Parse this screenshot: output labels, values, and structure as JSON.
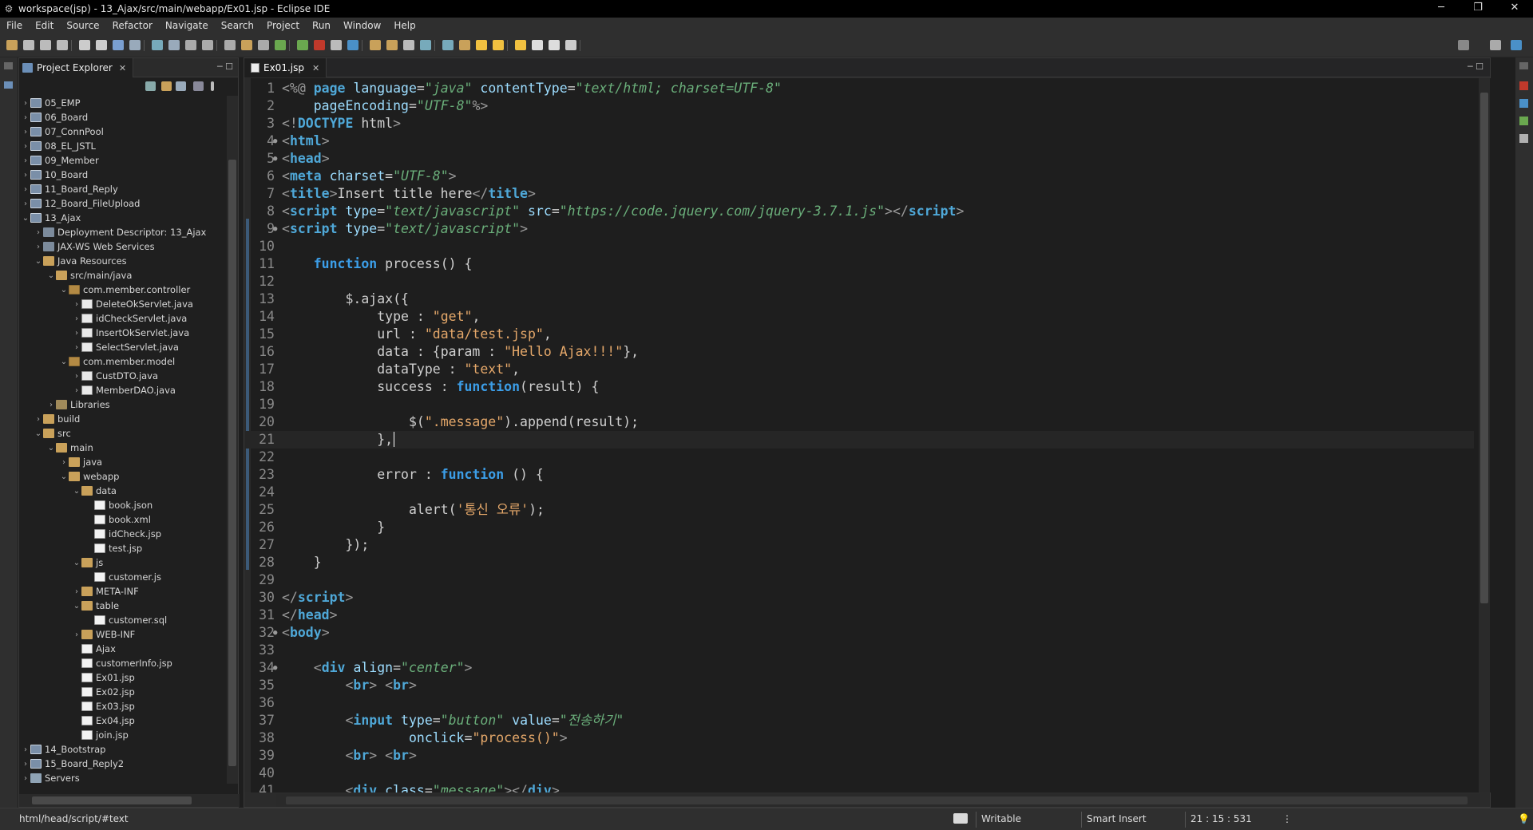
{
  "window": {
    "title": "workspace(jsp) - 13_Ajax/src/main/webapp/Ex01.jsp - Eclipse IDE",
    "minimize": "─",
    "restore": "❐",
    "close": "✕"
  },
  "menu": [
    "File",
    "Edit",
    "Source",
    "Refactor",
    "Navigate",
    "Search",
    "Project",
    "Run",
    "Window",
    "Help"
  ],
  "explorer": {
    "tab_label": "Project Explorer",
    "close": "✕",
    "minmax": "─ ☐",
    "tree": [
      {
        "label": "05_EMP",
        "depth": 0,
        "arrow": "›",
        "icon": "project"
      },
      {
        "label": "06_Board",
        "depth": 0,
        "arrow": "›",
        "icon": "project"
      },
      {
        "label": "07_ConnPool",
        "depth": 0,
        "arrow": "›",
        "icon": "project"
      },
      {
        "label": "08_EL_JSTL",
        "depth": 0,
        "arrow": "›",
        "icon": "project"
      },
      {
        "label": "09_Member",
        "depth": 0,
        "arrow": "›",
        "icon": "project"
      },
      {
        "label": "10_Board",
        "depth": 0,
        "arrow": "›",
        "icon": "project"
      },
      {
        "label": "11_Board_Reply",
        "depth": 0,
        "arrow": "›",
        "icon": "project"
      },
      {
        "label": "12_Board_FileUpload",
        "depth": 0,
        "arrow": "›",
        "icon": "project"
      },
      {
        "label": "13_Ajax",
        "depth": 0,
        "arrow": "⌄",
        "icon": "project"
      },
      {
        "label": "Deployment Descriptor: 13_Ajax",
        "depth": 1,
        "arrow": "›",
        "icon": "cfg"
      },
      {
        "label": "JAX-WS Web Services",
        "depth": 1,
        "arrow": "›",
        "icon": "cfg"
      },
      {
        "label": "Java Resources",
        "depth": 1,
        "arrow": "⌄",
        "icon": "folder"
      },
      {
        "label": "src/main/java",
        "depth": 2,
        "arrow": "⌄",
        "icon": "folder"
      },
      {
        "label": "com.member.controller",
        "depth": 3,
        "arrow": "⌄",
        "icon": "package"
      },
      {
        "label": "DeleteOkServlet.java",
        "depth": 4,
        "arrow": "›",
        "icon": "java"
      },
      {
        "label": "idCheckServlet.java",
        "depth": 4,
        "arrow": "›",
        "icon": "java"
      },
      {
        "label": "InsertOkServlet.java",
        "depth": 4,
        "arrow": "›",
        "icon": "java"
      },
      {
        "label": "SelectServlet.java",
        "depth": 4,
        "arrow": "›",
        "icon": "java"
      },
      {
        "label": "com.member.model",
        "depth": 3,
        "arrow": "⌄",
        "icon": "package"
      },
      {
        "label": "CustDTO.java",
        "depth": 4,
        "arrow": "›",
        "icon": "java"
      },
      {
        "label": "MemberDAO.java",
        "depth": 4,
        "arrow": "›",
        "icon": "java"
      },
      {
        "label": "Libraries",
        "depth": 2,
        "arrow": "›",
        "icon": "lib"
      },
      {
        "label": "build",
        "depth": 1,
        "arrow": "›",
        "icon": "folder"
      },
      {
        "label": "src",
        "depth": 1,
        "arrow": "⌄",
        "icon": "folder"
      },
      {
        "label": "main",
        "depth": 2,
        "arrow": "⌄",
        "icon": "folder"
      },
      {
        "label": "java",
        "depth": 3,
        "arrow": "›",
        "icon": "folder"
      },
      {
        "label": "webapp",
        "depth": 3,
        "arrow": "⌄",
        "icon": "folder"
      },
      {
        "label": "data",
        "depth": 4,
        "arrow": "⌄",
        "icon": "folder"
      },
      {
        "label": "book.json",
        "depth": 5,
        "arrow": "",
        "icon": "jsp"
      },
      {
        "label": "book.xml",
        "depth": 5,
        "arrow": "",
        "icon": "jsp"
      },
      {
        "label": "idCheck.jsp",
        "depth": 5,
        "arrow": "",
        "icon": "jsp"
      },
      {
        "label": "test.jsp",
        "depth": 5,
        "arrow": "",
        "icon": "jsp"
      },
      {
        "label": "js",
        "depth": 4,
        "arrow": "⌄",
        "icon": "folder"
      },
      {
        "label": "customer.js",
        "depth": 5,
        "arrow": "",
        "icon": "jsp"
      },
      {
        "label": "META-INF",
        "depth": 4,
        "arrow": "›",
        "icon": "folder"
      },
      {
        "label": "table",
        "depth": 4,
        "arrow": "⌄",
        "icon": "folder"
      },
      {
        "label": "customer.sql",
        "depth": 5,
        "arrow": "",
        "icon": "jsp"
      },
      {
        "label": "WEB-INF",
        "depth": 4,
        "arrow": "›",
        "icon": "folder"
      },
      {
        "label": "Ajax",
        "depth": 4,
        "arrow": "",
        "icon": "jsp"
      },
      {
        "label": "customerInfo.jsp",
        "depth": 4,
        "arrow": "",
        "icon": "jsp"
      },
      {
        "label": "Ex01.jsp",
        "depth": 4,
        "arrow": "",
        "icon": "jsp"
      },
      {
        "label": "Ex02.jsp",
        "depth": 4,
        "arrow": "",
        "icon": "jsp"
      },
      {
        "label": "Ex03.jsp",
        "depth": 4,
        "arrow": "",
        "icon": "jsp"
      },
      {
        "label": "Ex04.jsp",
        "depth": 4,
        "arrow": "",
        "icon": "jsp"
      },
      {
        "label": "join.jsp",
        "depth": 4,
        "arrow": "",
        "icon": "jsp"
      },
      {
        "label": "14_Bootstrap",
        "depth": 0,
        "arrow": "›",
        "icon": "project"
      },
      {
        "label": "15_Board_Reply2",
        "depth": 0,
        "arrow": "›",
        "icon": "project"
      },
      {
        "label": "Servers",
        "depth": 0,
        "arrow": "›",
        "icon": "server"
      }
    ]
  },
  "editor": {
    "tab_label": "Ex01.jsp",
    "close": "✕",
    "minmax": "─ ☐",
    "current_line": 21,
    "lines": [
      {
        "n": "1",
        "fold": "",
        "html": "<span class='pun'>&lt;%@</span> <span class='tag'>page</span> <span class='attr'>language</span><span class='jsp'>=</span><span class='aval'>\"java\"</span> <span class='attr'>contentType</span><span class='jsp'>=</span><span class='aval'>\"text/html; charset=UTF-8\"</span>"
      },
      {
        "n": "2",
        "fold": "",
        "html": "    <span class='attr'>pageEncoding</span><span class='jsp'>=</span><span class='aval'>\"UTF-8\"</span><span class='pun'>%&gt;</span>"
      },
      {
        "n": "3",
        "fold": "",
        "html": "<span class='pun'>&lt;!</span><span class='tag'>DOCTYPE</span> <span class='jsp'>html</span><span class='pun'>&gt;</span>"
      },
      {
        "n": "4",
        "fold": "●",
        "html": "<span class='pun'>&lt;</span><span class='tag'>html</span><span class='pun'>&gt;</span>"
      },
      {
        "n": "5",
        "fold": "●",
        "html": "<span class='pun'>&lt;</span><span class='tag'>head</span><span class='pun'>&gt;</span>"
      },
      {
        "n": "6",
        "fold": "",
        "html": "<span class='pun'>&lt;</span><span class='tag'>meta</span> <span class='attr'>charset</span><span class='jsp'>=</span><span class='aval'>\"UTF-8\"</span><span class='pun'>&gt;</span>"
      },
      {
        "n": "7",
        "fold": "",
        "html": "<span class='pun'>&lt;</span><span class='tag'>title</span><span class='pun'>&gt;</span><span class='jsp'>Insert title here</span><span class='pun'>&lt;/</span><span class='tag'>title</span><span class='pun'>&gt;</span>"
      },
      {
        "n": "8",
        "fold": "",
        "html": "<span class='pun'>&lt;</span><span class='tag'>script</span> <span class='attr'>type</span><span class='jsp'>=</span><span class='aval'>\"text/javascript\"</span> <span class='attr'>src</span><span class='jsp'>=</span><span class='aval'>\"https://code.jquery.com/jquery-3.7.1.js\"</span><span class='pun'>&gt;&lt;/</span><span class='tag'>script</span><span class='pun'>&gt;</span>"
      },
      {
        "n": "9",
        "fold": "●",
        "html": "<span class='pun'>&lt;</span><span class='tag'>script</span> <span class='attr'>type</span><span class='jsp'>=</span><span class='aval'>\"text/javascript\"</span><span class='pun'>&gt;</span>"
      },
      {
        "n": "10",
        "fold": "",
        "html": ""
      },
      {
        "n": "11",
        "fold": "",
        "html": "    <span class='kw'>function</span> <span class='jsp'>process() {</span>"
      },
      {
        "n": "12",
        "fold": "",
        "html": ""
      },
      {
        "n": "13",
        "fold": "",
        "html": "        <span class='jsp'>$.ajax({</span>"
      },
      {
        "n": "14",
        "fold": "",
        "html": "            <span class='jsp'>type : </span><span class='str'>\"get\"</span><span class='jsp'>,</span>"
      },
      {
        "n": "15",
        "fold": "",
        "html": "            <span class='jsp'>url : </span><span class='str'>\"data/test.jsp\"</span><span class='jsp'>,</span>"
      },
      {
        "n": "16",
        "fold": "",
        "html": "            <span class='jsp'>data : {param : </span><span class='str'>\"Hello Ajax!!!\"</span><span class='jsp'>},</span>"
      },
      {
        "n": "17",
        "fold": "",
        "html": "            <span class='jsp'>dataType : </span><span class='str'>\"text\"</span><span class='jsp'>,</span>"
      },
      {
        "n": "18",
        "fold": "",
        "html": "            <span class='jsp'>success : </span><span class='kw'>function</span><span class='jsp'>(result) {</span>"
      },
      {
        "n": "19",
        "fold": "",
        "html": ""
      },
      {
        "n": "20",
        "fold": "",
        "html": "                <span class='jsp'>$(</span><span class='str'>\".message\"</span><span class='jsp'>).append(result);</span>"
      },
      {
        "n": "21",
        "fold": "",
        "html": "            <span class='jsp'>},</span><span class='caret'></span>"
      },
      {
        "n": "22",
        "fold": "",
        "html": ""
      },
      {
        "n": "23",
        "fold": "",
        "html": "            <span class='jsp'>error : </span><span class='kw'>function</span> <span class='jsp'>() {</span>"
      },
      {
        "n": "24",
        "fold": "",
        "html": ""
      },
      {
        "n": "25",
        "fold": "",
        "html": "                <span class='jsp'>alert(</span><span class='str'>'통신 오류'</span><span class='jsp'>);</span>"
      },
      {
        "n": "26",
        "fold": "",
        "html": "            <span class='jsp'>}</span>"
      },
      {
        "n": "27",
        "fold": "",
        "html": "        <span class='jsp'>});</span>"
      },
      {
        "n": "28",
        "fold": "",
        "html": "    <span class='jsp'>}</span>"
      },
      {
        "n": "29",
        "fold": "",
        "html": ""
      },
      {
        "n": "30",
        "fold": "",
        "html": "<span class='pun'>&lt;/</span><span class='tag'>script</span><span class='pun'>&gt;</span>"
      },
      {
        "n": "31",
        "fold": "",
        "html": "<span class='pun'>&lt;/</span><span class='tag'>head</span><span class='pun'>&gt;</span>"
      },
      {
        "n": "32",
        "fold": "●",
        "html": "<span class='pun'>&lt;</span><span class='tag'>body</span><span class='pun'>&gt;</span>"
      },
      {
        "n": "33",
        "fold": "",
        "html": ""
      },
      {
        "n": "34",
        "fold": "●",
        "html": "    <span class='pun'>&lt;</span><span class='tag'>div</span> <span class='attr'>align</span><span class='jsp'>=</span><span class='aval'>\"center\"</span><span class='pun'>&gt;</span>"
      },
      {
        "n": "35",
        "fold": "",
        "html": "        <span class='pun'>&lt;</span><span class='tag'>br</span><span class='pun'>&gt;</span> <span class='pun'>&lt;</span><span class='tag'>br</span><span class='pun'>&gt;</span>"
      },
      {
        "n": "36",
        "fold": "",
        "html": ""
      },
      {
        "n": "37",
        "fold": "",
        "html": "        <span class='pun'>&lt;</span><span class='tag'>input</span> <span class='attr'>type</span><span class='jsp'>=</span><span class='aval'>\"button\"</span> <span class='attr'>value</span><span class='jsp'>=</span><span class='aval'>\"전송하기\"</span>"
      },
      {
        "n": "38",
        "fold": "",
        "html": "                <span class='attr'>onclick</span><span class='jsp'>=</span><span class='str'>\"process()\"</span><span class='pun'>&gt;</span>"
      },
      {
        "n": "39",
        "fold": "",
        "html": "        <span class='pun'>&lt;</span><span class='tag'>br</span><span class='pun'>&gt;</span> <span class='pun'>&lt;</span><span class='tag'>br</span><span class='pun'>&gt;</span>"
      },
      {
        "n": "40",
        "fold": "",
        "html": ""
      },
      {
        "n": "41",
        "fold": "",
        "html": "        <span class='pun'>&lt;</span><span class='tag'>div</span> <span class='attr'>class</span><span class='jsp'>=</span><span class='aval'>\"message\"</span><span class='pun'>&gt;&lt;/</span><span class='tag'>div</span><span class='pun'>&gt;</span>"
      }
    ]
  },
  "status": {
    "path": "html/head/script/#text",
    "writable": "Writable",
    "insert_mode": "Smart Insert",
    "position": "21 : 15 : 531"
  },
  "colors": {
    "background": "#1e1e1e",
    "tag": "#4fa8d8",
    "attribute_value": "#6aae7a",
    "string": "#e5a86a"
  }
}
